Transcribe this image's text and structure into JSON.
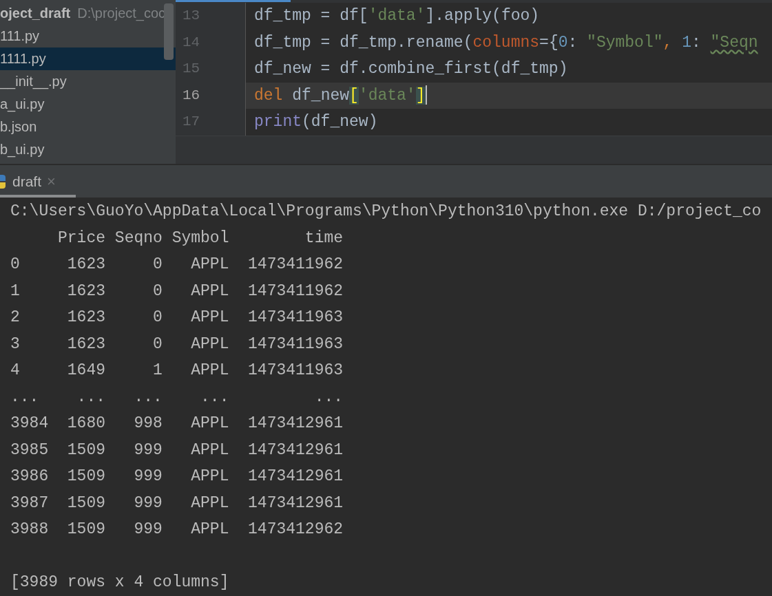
{
  "project_tree": {
    "root_name": "oject_draft",
    "root_path": "D:\\project_coc",
    "items": [
      {
        "name": "111.py",
        "selected": false
      },
      {
        "name": "1111.py",
        "selected": true
      },
      {
        "name": "__init__.py",
        "selected": false
      },
      {
        "name": "a_ui.py",
        "selected": false
      },
      {
        "name": "b.json",
        "selected": false
      },
      {
        "name": "b_ui.py",
        "selected": false
      }
    ]
  },
  "editor": {
    "lines": [
      {
        "number": "13",
        "current": false,
        "tokens": [
          {
            "kind": "plain",
            "text": "df_tmp = df["
          },
          {
            "kind": "string",
            "text": "'data'"
          },
          {
            "kind": "plain",
            "text": "].apply(foo)"
          }
        ]
      },
      {
        "number": "14",
        "current": false,
        "tokens": [
          {
            "kind": "plain",
            "text": "df_tmp = df_tmp.rename("
          },
          {
            "kind": "param",
            "text": "columns"
          },
          {
            "kind": "plain",
            "text": "={"
          },
          {
            "kind": "number",
            "text": "0"
          },
          {
            "kind": "plain",
            "text": ": "
          },
          {
            "kind": "string",
            "text": "\"Symbol\""
          },
          {
            "kind": "keyword",
            "text": ", "
          },
          {
            "kind": "number",
            "text": "1"
          },
          {
            "kind": "plain",
            "text": ": "
          },
          {
            "kind": "string",
            "text": "\"Seqn",
            "warning": true
          }
        ]
      },
      {
        "number": "15",
        "current": false,
        "tokens": [
          {
            "kind": "plain",
            "text": "df_new = df.combine_first(df_tmp)"
          }
        ]
      },
      {
        "number": "16",
        "current": true,
        "tokens": [
          {
            "kind": "keyword",
            "text": "del"
          },
          {
            "kind": "plain",
            "text": " df_new"
          },
          {
            "kind": "bracket",
            "text": "["
          },
          {
            "kind": "string",
            "text": "'data'"
          },
          {
            "kind": "bracket",
            "text": "]"
          }
        ],
        "caret": true
      },
      {
        "number": "17",
        "current": false,
        "tokens": [
          {
            "kind": "builtin",
            "text": "print"
          },
          {
            "kind": "plain",
            "text": "(df_new)"
          }
        ]
      }
    ]
  },
  "run_tab": {
    "label": "draft",
    "close": "×"
  },
  "console": {
    "lines": [
      "C:\\Users\\GuoYo\\AppData\\Local\\Programs\\Python\\Python310\\python.exe D:/project_co",
      "     Price Seqno Symbol        time",
      "0     1623     0   APPL  1473411962",
      "1     1623     0   APPL  1473411962",
      "2     1623     0   APPL  1473411963",
      "3     1623     0   APPL  1473411963",
      "4     1649     1   APPL  1473411963",
      "...    ...   ...    ...         ...",
      "3984  1680   998   APPL  1473412961",
      "3985  1509   999   APPL  1473412961",
      "3986  1509   999   APPL  1473412961",
      "3987  1509   999   APPL  1473412961",
      "3988  1509   999   APPL  1473412962"
    ],
    "summary": "[3989 rows x 4 columns]"
  }
}
